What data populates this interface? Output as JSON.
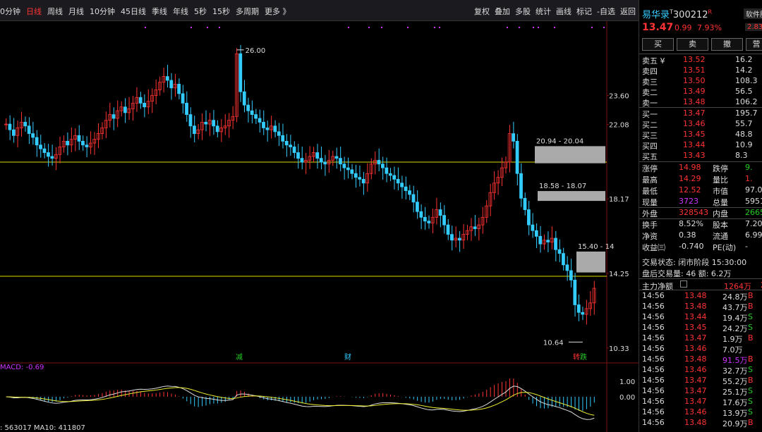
{
  "toolbar": {
    "period_tabs": [
      "0分钟",
      "日线",
      "周线",
      "月线",
      "10分钟",
      "45日线",
      "季线",
      "年线",
      "5秒",
      "15秒",
      "多周期",
      "更多 》"
    ],
    "active_tab": "日线",
    "tools": [
      "复权",
      "叠加",
      "多股",
      "统计",
      "画线",
      "标记",
      "-自选",
      "返回"
    ]
  },
  "stock": {
    "name": "易华录",
    "sup": "T",
    "code": "300212",
    "r_badge": "R",
    "price": "13.47",
    "change": "0.99",
    "pct": "7.93%",
    "sector": "软件服",
    "sector_val": "2.83"
  },
  "trade_buttons": [
    "买",
    "卖",
    "撤",
    "营"
  ],
  "orderbook": {
    "asks": [
      {
        "label": "卖五 ¥",
        "price": "13.52",
        "vol": "16.2"
      },
      {
        "label": "卖四",
        "price": "13.51",
        "vol": "14.2"
      },
      {
        "label": "卖三",
        "price": "13.50",
        "vol": "108.3"
      },
      {
        "label": "卖二",
        "price": "13.49",
        "vol": "56.5"
      },
      {
        "label": "卖一",
        "price": "13.48",
        "vol": "106.2"
      }
    ],
    "bids": [
      {
        "label": "买一",
        "price": "13.47",
        "vol": "195.7"
      },
      {
        "label": "买二",
        "price": "13.46",
        "vol": "55.7"
      },
      {
        "label": "买三",
        "price": "13.45",
        "vol": "48.8"
      },
      {
        "label": "买四",
        "price": "13.44",
        "vol": "10.9"
      },
      {
        "label": "买五",
        "price": "13.43",
        "vol": "8.3"
      }
    ]
  },
  "quote": [
    [
      "涨停",
      "14.98",
      "跌停",
      "9."
    ],
    [
      "最高",
      "14.29",
      "量比",
      "1."
    ],
    [
      "最低",
      "12.52",
      "市值",
      "97.0"
    ],
    [
      "现量",
      "3723",
      "总量",
      "5951"
    ],
    [
      "外盘",
      "328543",
      "内盘",
      "2665"
    ],
    [
      "换手",
      "8.52%",
      "股本",
      "7.20"
    ],
    [
      "净资",
      "0.38",
      "流通",
      "6.99"
    ],
    [
      "收益㈢",
      "-0.740",
      "PE(动)",
      "-"
    ]
  ],
  "status": {
    "line1": "交易状态: 闭市阶段 15:30:00",
    "line2": "盘后交易量: 46  额: 6.2万"
  },
  "main_flow": {
    "label": "主力净额",
    "value": "1264万",
    "tail": "2"
  },
  "ticks": [
    {
      "t": "14:56",
      "p": "13.48",
      "v": "24.8万",
      "s": "B"
    },
    {
      "t": "14:56",
      "p": "13.48",
      "v": "43.7万",
      "s": "B"
    },
    {
      "t": "14:56",
      "p": "13.44",
      "v": "19.4万",
      "s": "S"
    },
    {
      "t": "14:56",
      "p": "13.45",
      "v": "24.2万",
      "s": "S"
    },
    {
      "t": "14:56",
      "p": "13.47",
      "v": "1.9万",
      "s": "B"
    },
    {
      "t": "14:56",
      "p": "13.46",
      "v": "7.0万",
      "s": ""
    },
    {
      "t": "14:56",
      "p": "13.48",
      "v": "91.5万",
      "s": "B"
    },
    {
      "t": "14:56",
      "p": "13.46",
      "v": "32.7万",
      "s": "S"
    },
    {
      "t": "14:56",
      "p": "13.47",
      "v": "55.2万",
      "s": "B"
    },
    {
      "t": "14:56",
      "p": "13.47",
      "v": "25.1万",
      "s": "S"
    },
    {
      "t": "14:56",
      "p": "13.47",
      "v": "17.6万",
      "s": "S"
    },
    {
      "t": "14:56",
      "p": "13.46",
      "v": "13.9万",
      "s": "S"
    },
    {
      "t": "14:56",
      "p": "13.48",
      "v": "20.9万",
      "s": "B"
    }
  ],
  "chart_data": {
    "type": "candlestick",
    "price_axis": [
      "23.60",
      "22.08",
      "18.17",
      "14.25",
      "10.33"
    ],
    "macd_axis": [
      "1.00",
      "0.00"
    ],
    "high_label": "26.00",
    "low_label": "10.64",
    "gaps": [
      {
        "label": "20.94 - 20.04",
        "hi": 20.94,
        "lo": 20.04
      },
      {
        "label": "18.58 - 18.07",
        "hi": 18.58,
        "lo": 18.07
      },
      {
        "label": "15.40 - 14",
        "hi": 15.4,
        "lo": 14.3
      }
    ],
    "support_lines": [
      20.1,
      14.1
    ],
    "event_marks": [
      "减",
      "财",
      "转",
      "跌"
    ],
    "macd_label": "MACD: -0.69",
    "ma_label": ": 563017  MA10: 411807",
    "closes": [
      22.1,
      21.8,
      21.5,
      21.9,
      22.2,
      22.0,
      21.6,
      21.4,
      21.0,
      20.8,
      20.6,
      20.4,
      20.3,
      20.5,
      20.9,
      21.2,
      21.0,
      21.3,
      21.5,
      21.2,
      21.0,
      20.9,
      21.1,
      21.3,
      21.6,
      21.9,
      22.3,
      22.6,
      22.4,
      22.8,
      23.0,
      22.7,
      22.9,
      23.2,
      23.5,
      23.2,
      23.0,
      23.3,
      23.6,
      23.9,
      24.3,
      24.6,
      24.4,
      24.0,
      24.2,
      23.7,
      23.2,
      22.6,
      22.0,
      21.6,
      21.8,
      22.2,
      22.1,
      22.3,
      22.0,
      21.7,
      21.9,
      22.0,
      22.3,
      22.5,
      25.8,
      23.8,
      23.1,
      22.8,
      22.6,
      22.4,
      22.2,
      21.9,
      21.8,
      22.0,
      21.7,
      21.5,
      21.2,
      21.0,
      20.9,
      20.6,
      20.3,
      20.1,
      20.2,
      20.4,
      20.6,
      20.3,
      20.1,
      20.0,
      20.2,
      20.4,
      20.3,
      20.0,
      19.8,
      19.7,
      19.5,
      19.3,
      19.2,
      19.0,
      19.5,
      20.0,
      20.2,
      20.0,
      19.8,
      19.5,
      19.4,
      19.2,
      19.0,
      18.8,
      18.6,
      18.4,
      18.0,
      17.5,
      17.2,
      17.0,
      16.9,
      17.2,
      17.6,
      17.3,
      16.8,
      16.3,
      16.0,
      16.1,
      16.0,
      16.3,
      16.5,
      16.7,
      16.6,
      16.8,
      17.2,
      17.8,
      18.5,
      19.0,
      19.3,
      19.8,
      20.1,
      21.6,
      21.2,
      19.5,
      18.2,
      17.6,
      16.8,
      16.5,
      16.2,
      15.8,
      16.0,
      15.9,
      16.1,
      15.5,
      15.3,
      14.7,
      14.4,
      13.9,
      12.6,
      12.2,
      12.1,
      12.4,
      12.7,
      13.47
    ]
  }
}
